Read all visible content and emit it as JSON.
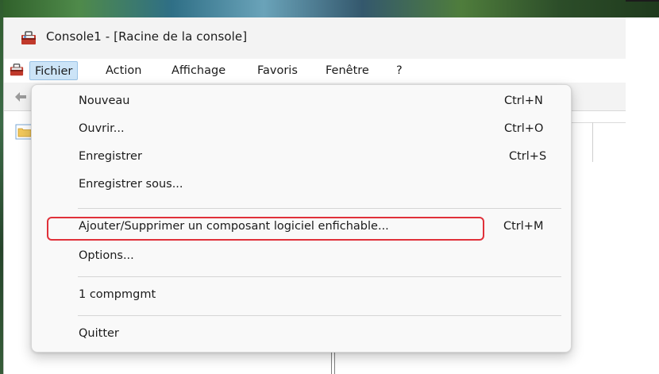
{
  "window": {
    "title": "Console1 - [Racine de la console]"
  },
  "menubar": {
    "items": [
      {
        "label": "Fichier"
      },
      {
        "label": "Action"
      },
      {
        "label": "Affichage"
      },
      {
        "label": "Favoris"
      },
      {
        "label": "Fenêtre"
      },
      {
        "label": "?"
      }
    ]
  },
  "dropdown": {
    "items": [
      {
        "label": "Nouveau",
        "shortcut": "Ctrl+N"
      },
      {
        "label": "Ouvrir...",
        "shortcut": "Ctrl+O"
      },
      {
        "label": "Enregistrer",
        "shortcut": "Ctrl+S"
      },
      {
        "label": "Enregistrer sous...",
        "shortcut": ""
      },
      {
        "label": "Ajouter/Supprimer un composant logiciel enfichable...",
        "shortcut": "Ctrl+M"
      },
      {
        "label": "Options...",
        "shortcut": ""
      },
      {
        "label": "1 compmgmt",
        "shortcut": ""
      },
      {
        "label": "Quitter",
        "shortcut": ""
      }
    ]
  },
  "colors": {
    "menu_active_bg": "#cce4f7",
    "highlight_border": "#e0313a",
    "dropdown_bg": "#f9f9f9"
  },
  "icons": {
    "title": "mmc-toolbox-icon",
    "system_menu": "mmc-toolbox-icon",
    "toolbar_back": "back-arrow-icon",
    "tree_root": "folder-icon"
  }
}
